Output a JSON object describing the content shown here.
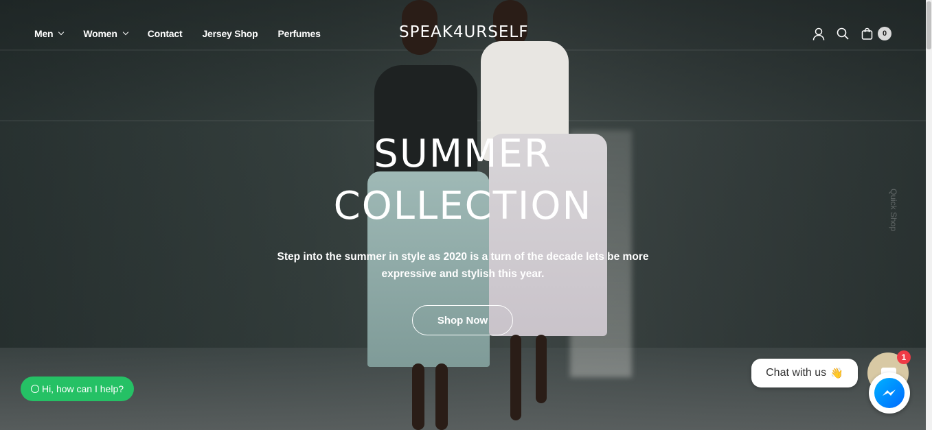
{
  "header": {
    "nav": [
      {
        "label": "Men",
        "has_dropdown": true
      },
      {
        "label": "Women",
        "has_dropdown": true
      },
      {
        "label": "Contact",
        "has_dropdown": false
      },
      {
        "label": "Jersey Shop",
        "has_dropdown": false
      },
      {
        "label": "Perfumes",
        "has_dropdown": false
      }
    ],
    "logo": "SPEAK4URSELF",
    "icons": [
      "account-icon",
      "search-icon",
      "cart-icon"
    ],
    "cart_count": "0"
  },
  "hero": {
    "title_line1": "SUMMER",
    "title_line2": "COLLECTION",
    "subtitle": "Step into the summer in style as 2020 is a turn of the decade lets be more expressive and stylish this year.",
    "cta": "Shop Now"
  },
  "side_tab": {
    "label": "Quick Shop"
  },
  "whatsapp": {
    "label": "Hi, how can I help?",
    "color": "#25c165"
  },
  "chat": {
    "bubble_text": "Chat with us",
    "wave_emoji": "👋",
    "notification_count": "1",
    "messenger_color": "#0084ff"
  }
}
